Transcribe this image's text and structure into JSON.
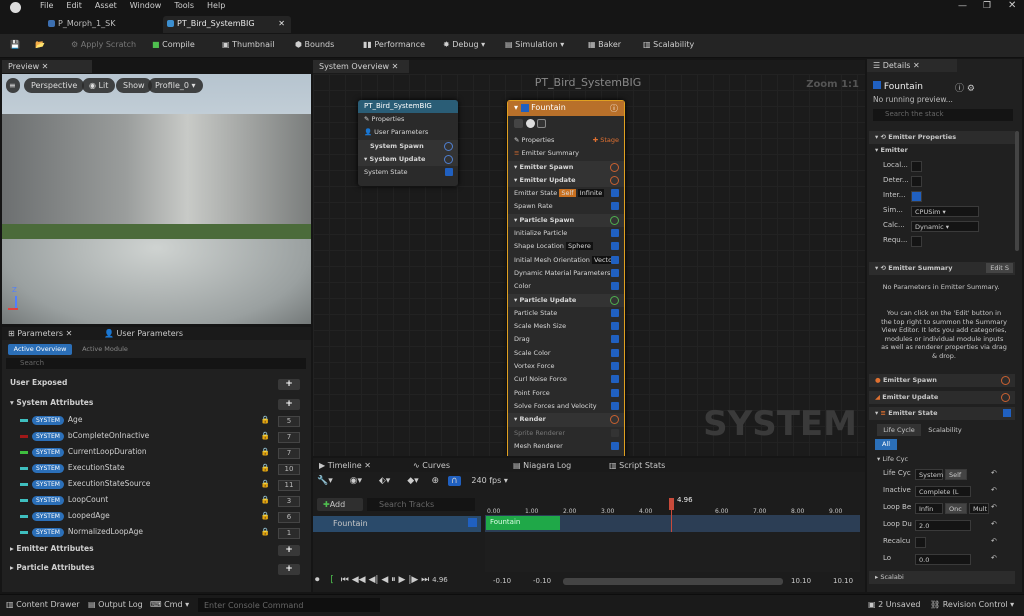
{
  "menu": [
    "File",
    "Edit",
    "Asset",
    "Window",
    "Tools",
    "Help"
  ],
  "tabs": [
    "P_Morph_1_SK",
    "PT_Bird_SystemBIG"
  ],
  "toolbar": {
    "save": "",
    "apply_scratch": "Apply Scratch",
    "compile": "Compile",
    "thumbnail": "Thumbnail",
    "bounds": "Bounds",
    "performance": "Performance",
    "debug": "Debug",
    "simulation": "Simulation",
    "baker": "Baker",
    "scalability": "Scalability"
  },
  "preview": {
    "title": "Preview",
    "perspective": "Perspective",
    "lit": "Lit",
    "show": "Show",
    "profile": "Profile_0"
  },
  "graph": {
    "tab": "System Overview",
    "title": "PT_Bird_SystemBIG",
    "zoom": "Zoom 1:1",
    "watermark": "SYSTEM",
    "system_node": {
      "title": "PT_Bird_SystemBIG",
      "rows": [
        "Properties",
        "User Parameters",
        "System Spawn",
        "System Update",
        "System State"
      ]
    },
    "emitter_node": {
      "title": "Fountain",
      "properties": "Properties",
      "stage": "Stage",
      "rows": [
        "Emitter Summary",
        "Emitter Spawn",
        "Emitter Update",
        "Emitter State",
        "Spawn Rate",
        "Particle Spawn",
        "Initialize Particle",
        "Shape Location",
        "Initial Mesh Orientation",
        "Dynamic Material Parameters",
        "Color",
        "Particle Update",
        "Particle State",
        "Scale Mesh Size",
        "Drag",
        "Scale Color",
        "Vortex Force",
        "Curl Noise Force",
        "Point Force",
        "Solve Forces and Velocity",
        "Render",
        "Sprite Renderer",
        "Mesh Renderer"
      ],
      "emitter_state_badges": [
        "Self",
        "Infinite"
      ],
      "shape_badge": "Sphere",
      "orient_badge": "Vector"
    }
  },
  "parameters": {
    "tab1": "Parameters",
    "tab2": "User Parameters",
    "active_overview": "Active Overview",
    "active_module": "Active Module",
    "search_placeholder": "Search",
    "user_exposed": "User Exposed",
    "system_attributes": "System Attributes",
    "badge": "SYSTEM",
    "attributes": [
      {
        "name": "Age",
        "count": "5",
        "color": "#3fbfbf"
      },
      {
        "name": "bCompleteOnInactive",
        "count": "7",
        "color": "#a01818"
      },
      {
        "name": "CurrentLoopDuration",
        "count": "7",
        "color": "#3fbf3f"
      },
      {
        "name": "ExecutionState",
        "count": "10",
        "color": "#3fbfbf"
      },
      {
        "name": "ExecutionStateSource",
        "count": "11",
        "color": "#3fbfbf"
      },
      {
        "name": "LoopCount",
        "count": "3",
        "color": "#3fbfbf"
      },
      {
        "name": "LoopedAge",
        "count": "6",
        "color": "#3fbfbf"
      },
      {
        "name": "NormalizedLoopAge",
        "count": "1",
        "color": "#3fbfbf"
      }
    ],
    "emitter_attributes": "Emitter Attributes",
    "particle_attributes": "Particle Attributes"
  },
  "timeline": {
    "tabs": [
      "Timeline",
      "Curves",
      "Niagara Log",
      "Script Stats"
    ],
    "add": "Add",
    "search_placeholder": "Search Tracks",
    "fps": "240 fps",
    "playhead": "4.96",
    "track": "Fountain",
    "clip": "Fountain",
    "ticks": [
      "0.00",
      "1.00",
      "2.00",
      "3.00",
      "4.00",
      "6.00",
      "7.00",
      "8.00",
      "9.00"
    ],
    "time_current": "4.96",
    "range_start": "-0.10",
    "range_start2": "-0.10",
    "range_end": "10.10",
    "range_end2": "10.10"
  },
  "details": {
    "title": "Details",
    "emitter": "Fountain",
    "no_preview": "No running preview...",
    "search_placeholder": "Search the stack",
    "emitter_properties": "Emitter Properties",
    "emitter_label": "Emitter",
    "rows": [
      {
        "label": "Local..."
      },
      {
        "label": "Deter..."
      },
      {
        "label": "Inter..."
      },
      {
        "label": "Sim...",
        "value": "CPUSim"
      },
      {
        "label": "Calc...",
        "value": "Dynamic"
      },
      {
        "label": "Requ..."
      }
    ],
    "emitter_summary": "Emitter Summary",
    "edit": "Edit S",
    "summary_msg1": "No Parameters in Emitter Summary.",
    "summary_msg2": "You can click on the 'Edit' button in the top right to summon the Summary View Editor. It lets you add categories, modules or individual module inputs as well as renderer properties via drag & drop.",
    "emitter_spawn": "Emitter Spawn",
    "emitter_update": "Emitter Update",
    "emitter_state": "Emitter State",
    "life_cycle": "Life Cycle",
    "scalability": "Scalability",
    "all": "All",
    "life_cyc": "Life Cyc",
    "rows2": [
      {
        "label": "Life Cyc",
        "value": "System",
        "value2": "Self"
      },
      {
        "label": "Inactive",
        "value": "Complete (L"
      },
      {
        "label": "Loop Be",
        "value": "Infin",
        "value2": "Onc",
        "value3": "Mult"
      },
      {
        "label": "Loop Du",
        "value": "2.0"
      },
      {
        "label": "Recalcu"
      },
      {
        "label": "Lo",
        "value": "0.0"
      }
    ],
    "scalab": "Scalabi"
  },
  "status": {
    "content_drawer": "Content Drawer",
    "output_log": "Output Log",
    "cmd": "Cmd",
    "console_placeholder": "Enter Console Command",
    "unsaved": "2 Unsaved",
    "revision": "Revision Control"
  }
}
